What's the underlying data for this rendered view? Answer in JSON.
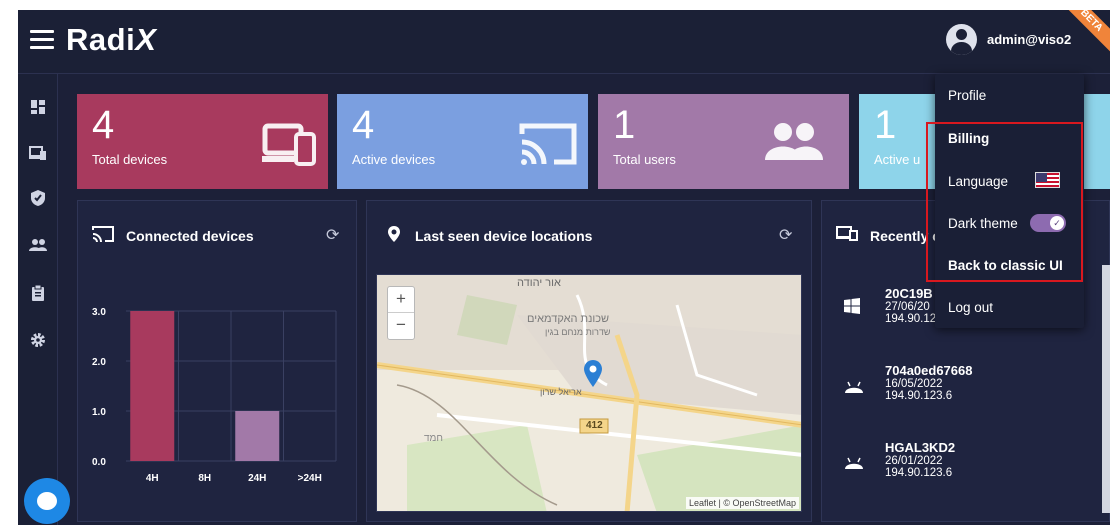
{
  "brand": {
    "logo_main": "Radi",
    "logo_x": "X",
    "beta_badge": "BETA"
  },
  "user": {
    "email": "admin@viso2"
  },
  "stats": [
    {
      "value": "4",
      "label": "Total devices",
      "color": "#a83a5e",
      "icon": "devices-icon"
    },
    {
      "value": "4",
      "label": "Active devices",
      "color": "#7b9fe0",
      "icon": "cast-icon"
    },
    {
      "value": "1",
      "label": "Total users",
      "color": "#a279a8",
      "icon": "users-icon"
    },
    {
      "value": "1",
      "label": "Active u",
      "color": "#8ed4ea",
      "icon": "users-icon"
    }
  ],
  "connected_card": {
    "title": "Connected devices",
    "chart_data": {
      "type": "bar",
      "categories": [
        "4H",
        "8H",
        "24H",
        ">24H"
      ],
      "values": [
        3,
        0,
        1,
        0
      ],
      "colors": [
        "#a83a5e",
        "#a83a5e",
        "#a279a8",
        "#a279a8"
      ],
      "ylim": [
        0,
        3
      ],
      "yticks": [
        "0.0",
        "1.0",
        "2.0",
        "3.0"
      ]
    }
  },
  "map_card": {
    "title": "Last seen device locations",
    "zoom_in": "+",
    "zoom_out": "−",
    "attribution": "Leaflet | © OpenStreetMap",
    "labels": {
      "city": "אור יהודה",
      "neighborhood": "שכונת האקדמאים",
      "street1": "שדרות מנחם בגין",
      "street2": "אריאל שרון",
      "road": "412",
      "place": "חמד"
    }
  },
  "recent_card": {
    "title": "Recently c",
    "devices": [
      {
        "id": "20C19B",
        "date": "27/06/20",
        "ip": "194.90.123.22",
        "os": "windows-icon"
      },
      {
        "id": "704a0ed67668",
        "date": "16/05/2022",
        "ip": "194.90.123.6",
        "os": "android-icon"
      },
      {
        "id": "HGAL3KD2",
        "date": "26/01/2022",
        "ip": "194.90.123.6",
        "os": "android-icon"
      }
    ]
  },
  "menu": {
    "profile": "Profile",
    "billing": "Billing",
    "language": "Language",
    "dark_theme": "Dark theme",
    "classic": "Back to classic UI",
    "logout": "Log out"
  }
}
